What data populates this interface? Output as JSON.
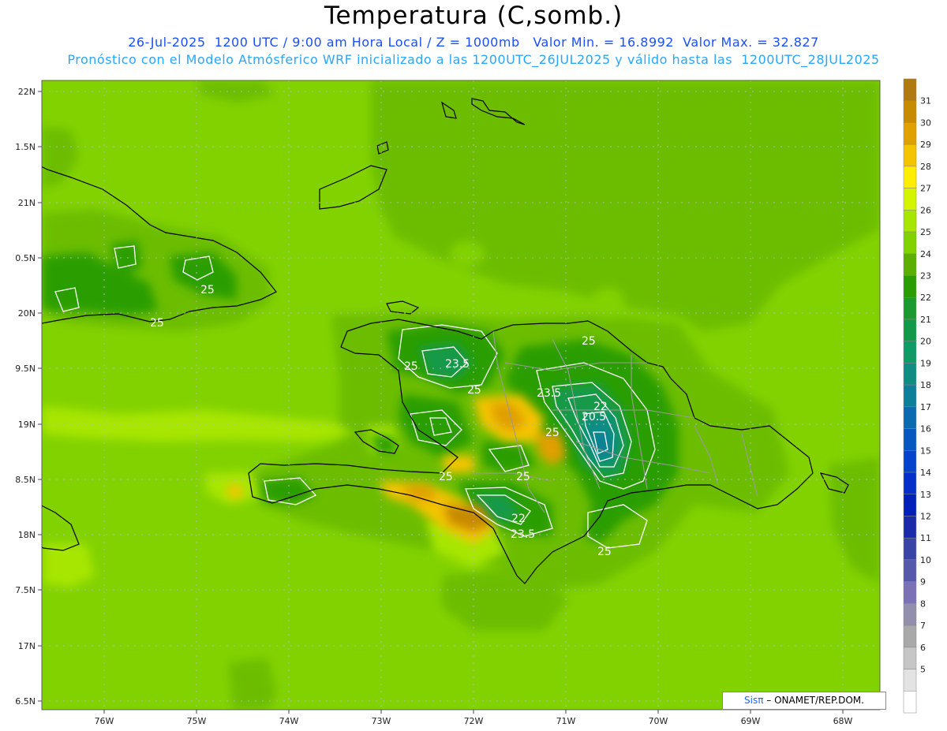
{
  "header": {
    "title": "Temperatura (C,somb.)",
    "date": "26-Jul-2025",
    "time_utc": "1200 UTC",
    "local_time": "9:00 am Hora Local",
    "level": "Z = 1000mb",
    "min_value": "16.8992",
    "max_value": "32.827",
    "line1": "26-Jul-2025  1200 UTC / 9:00 am Hora Local / Z = 1000mb   Valor Min. = 16.8992  Valor Max. = 32.827",
    "line2": "Pronóstico con el Modelo Atmósferico WRF inicializado a las 1200UTC_26JUL2025 y válido hasta las  1200UTC_28JUL2025"
  },
  "axes": {
    "lat_ticks": [
      "22N",
      "1.5N",
      "21N",
      "0.5N",
      "20N",
      "9.5N",
      "19N",
      "8.5N",
      "18N",
      "7.5N",
      "17N",
      "6.5N"
    ],
    "lon_ticks": [
      "76W",
      "75W",
      "74W",
      "73W",
      "72W",
      "71W",
      "70W",
      "69W",
      "68W"
    ]
  },
  "contour_labels": [
    "25",
    "25",
    "25",
    "23.5",
    "25",
    "23.5",
    "22",
    "20.5",
    "25",
    "25",
    "25",
    "22",
    "23.5",
    "25",
    "25",
    "25"
  ],
  "colorbar": {
    "levels": [
      "31",
      "30",
      "29",
      "28",
      "27",
      "26",
      "25",
      "24",
      "23",
      "22",
      "21",
      "20",
      "19",
      "18",
      "17",
      "16",
      "15",
      "14",
      "13",
      "12",
      "11",
      "10",
      "9",
      "8",
      "7",
      "6",
      "5"
    ],
    "colors": [
      "#c88a00",
      "#e0a000",
      "#f5c400",
      "#ffee00",
      "#d4f500",
      "#a7e600",
      "#82d200",
      "#5aaf00",
      "#2a9e00",
      "#1d9a2f",
      "#129a4a",
      "#0f9a66",
      "#108d83",
      "#0e7f98",
      "#0a6bb0",
      "#0757c0",
      "#0443cc",
      "#0230c8",
      "#0020b8",
      "#1a2aa8",
      "#3a44a6",
      "#5658ac",
      "#7a72b4",
      "#918fab",
      "#a9a9a9",
      "#c6c6c6",
      "#e3e3e3"
    ],
    "top_color": "#b07a10",
    "bottom_color": "#ffffff"
  },
  "credit": {
    "brand": "Sisπ",
    "text": " – ONAMET/REP.DOM."
  }
}
